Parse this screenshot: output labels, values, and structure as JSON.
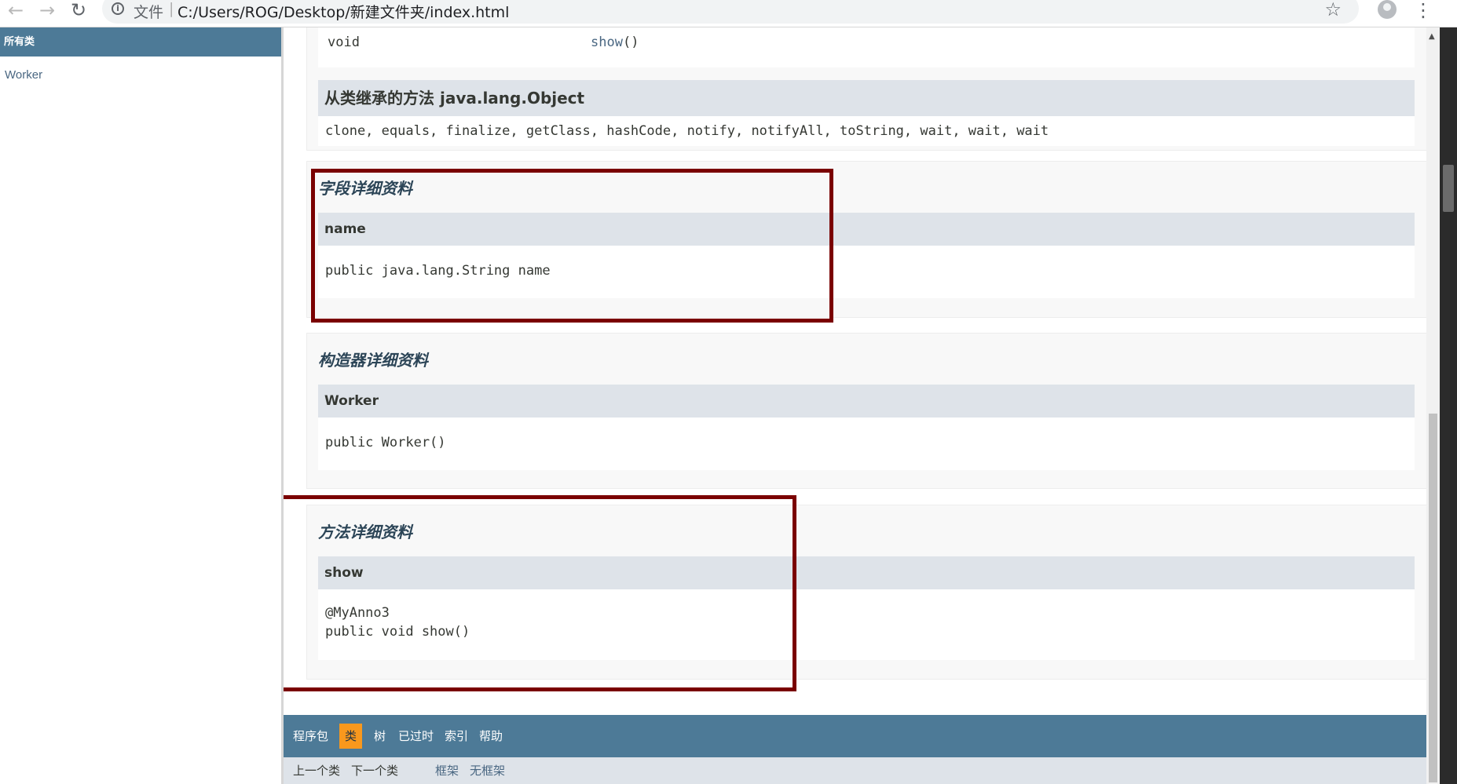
{
  "browser": {
    "back_icon": "←",
    "forward_icon": "→",
    "reload_icon": "↻",
    "info_icon": "i",
    "file_label": "文件",
    "separator": "|",
    "url": "C:/Users/ROG/Desktop/新建文件夹/index.html",
    "star_icon": "☆",
    "menu_icon": "⋮"
  },
  "left_frame": {
    "header": "所有类",
    "classes": [
      "Worker"
    ]
  },
  "method_summary_tail": {
    "modifier": "void",
    "method_link": "show",
    "method_parens": "()"
  },
  "inherited": {
    "title": "从类继承的方法 java.lang.Object",
    "methods": "clone, equals, finalize, getClass, hashCode, notify, notifyAll, toString, wait, wait, wait"
  },
  "field_detail": {
    "title": "字段详细资料",
    "name": "name",
    "signature": "public java.lang.String name"
  },
  "constructor_detail": {
    "title": "构造器详细资料",
    "name": "Worker",
    "signature": "public Worker()"
  },
  "method_detail": {
    "title": "方法详细资料",
    "name": "show",
    "annotation": "@MyAnno3",
    "signature": "public void show()"
  },
  "bottom_nav": {
    "items": [
      "程序包",
      "类",
      "树",
      "已过时",
      "索引",
      "帮助"
    ],
    "active": "类",
    "sub_items": [
      "上一个类",
      "下一个类",
      "框架",
      "无框架"
    ]
  },
  "colors": {
    "nav_blue": "#4d7a97",
    "active_orange": "#f8981d",
    "header_band": "#dee3e9",
    "highlight_red": "#7a0000"
  }
}
